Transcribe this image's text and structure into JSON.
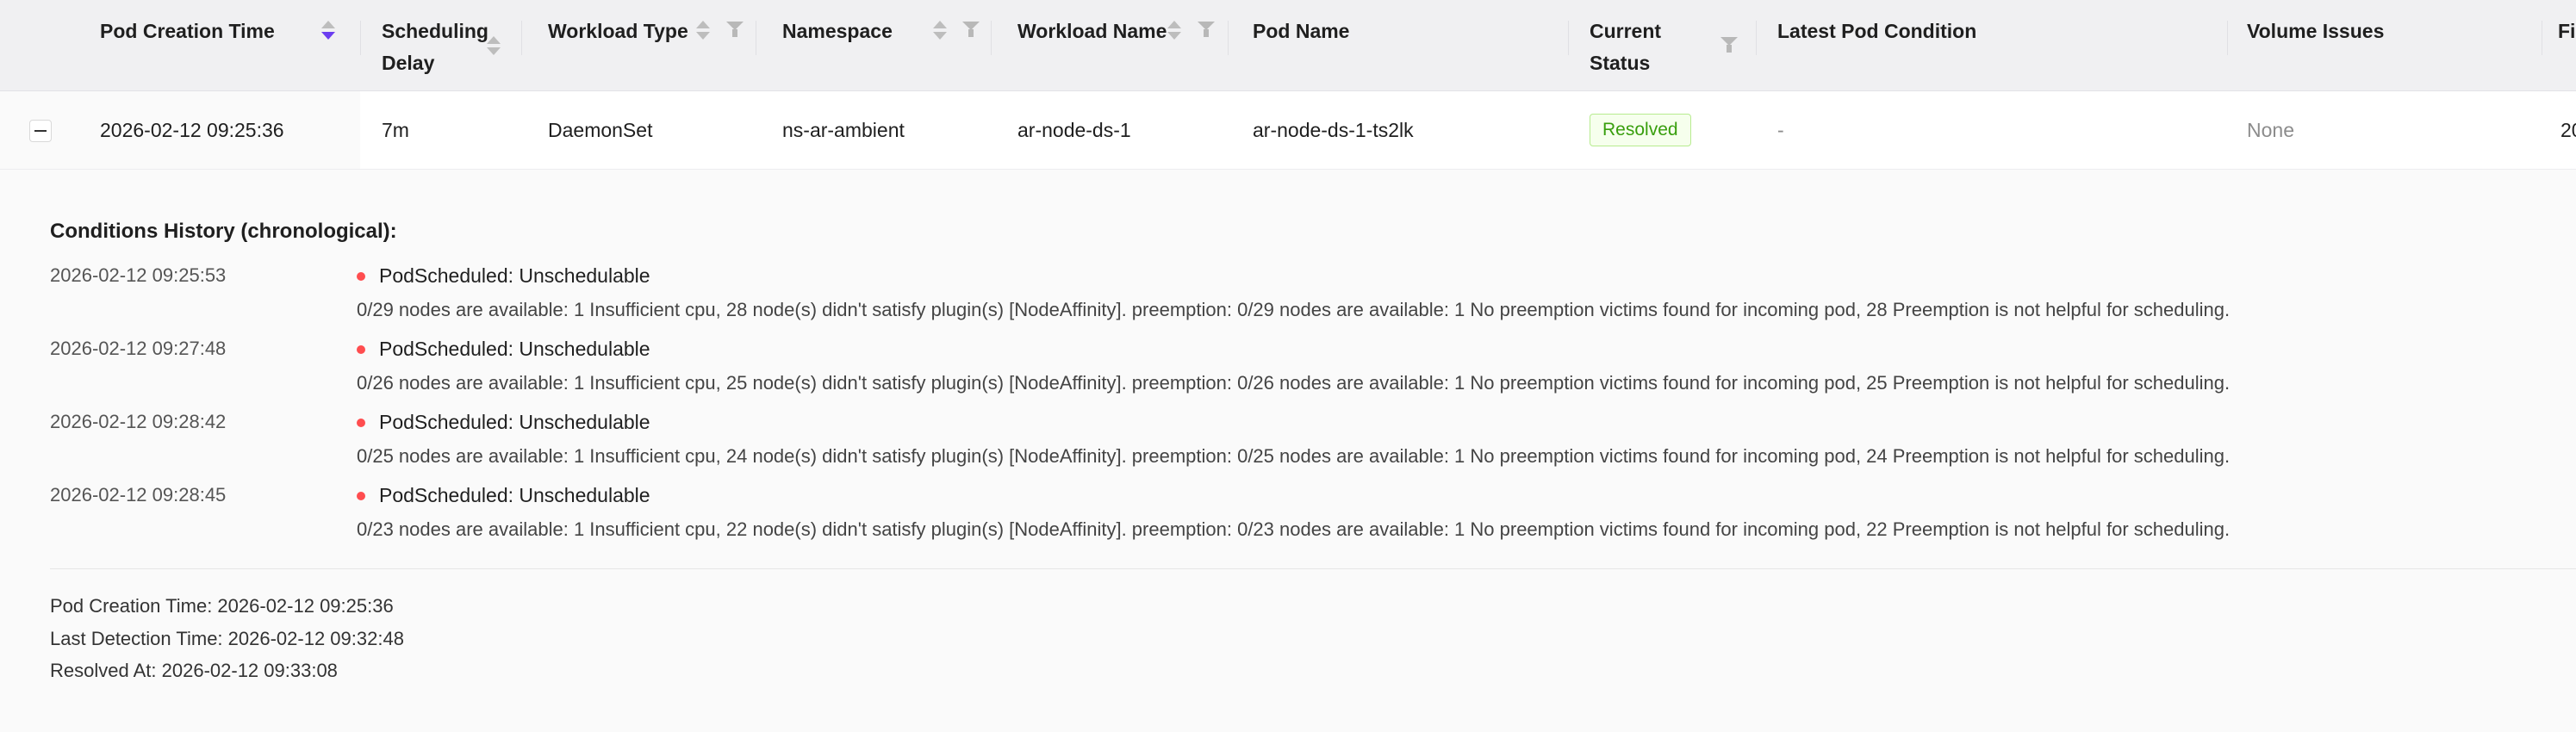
{
  "columns": {
    "pod_creation_time": "Pod Creation Time",
    "scheduling_delay_line1": "Scheduling",
    "scheduling_delay_line2": "Delay",
    "workload_type": "Workload Type",
    "namespace": "Namespace",
    "workload_name": "Workload Name",
    "pod_name": "Pod Name",
    "current_status_line1": "Current",
    "current_status_line2": "Status",
    "latest_pod_condition": "Latest Pod Condition",
    "volume_issues": "Volume Issues",
    "truncated_next": "Fi"
  },
  "row": {
    "pod_creation_time": "2026-02-12 09:25:36",
    "scheduling_delay": "7m",
    "workload_type": "DaemonSet",
    "namespace": "ns-ar-ambient",
    "workload_name": "ar-node-ds-1",
    "pod_name": "ar-node-ds-1-ts2lk",
    "current_status": "Resolved",
    "latest_pod_condition": "-",
    "volume_issues": "None",
    "truncated_next": "20"
  },
  "expanded": {
    "history_title": "Conditions History (chronological):",
    "history": [
      {
        "time": "2026-02-12 09:25:53",
        "reason": "PodScheduled: Unschedulable",
        "message": "0/29 nodes are available: 1 Insufficient cpu, 28 node(s) didn't satisfy plugin(s) [NodeAffinity]. preemption: 0/29 nodes are available: 1 No preemption victims found for incoming pod, 28 Preemption is not helpful for scheduling."
      },
      {
        "time": "2026-02-12 09:27:48",
        "reason": "PodScheduled: Unschedulable",
        "message": "0/26 nodes are available: 1 Insufficient cpu, 25 node(s) didn't satisfy plugin(s) [NodeAffinity]. preemption: 0/26 nodes are available: 1 No preemption victims found for incoming pod, 25 Preemption is not helpful for scheduling."
      },
      {
        "time": "2026-02-12 09:28:42",
        "reason": "PodScheduled: Unschedulable",
        "message": "0/25 nodes are available: 1 Insufficient cpu, 24 node(s) didn't satisfy plugin(s) [NodeAffinity]. preemption: 0/25 nodes are available: 1 No preemption victims found for incoming pod, 24 Preemption is not helpful for scheduling."
      },
      {
        "time": "2026-02-12 09:28:45",
        "reason": "PodScheduled: Unschedulable",
        "message": "0/23 nodes are available: 1 Insufficient cpu, 22 node(s) didn't satisfy plugin(s) [NodeAffinity]. preemption: 0/23 nodes are available: 1 No preemption victims found for incoming pod, 22 Preemption is not helpful for scheduling."
      }
    ],
    "pod_creation_time": "Pod Creation Time: 2026-02-12 09:25:36",
    "last_detection_time": "Last Detection Time: 2026-02-12 09:32:48",
    "resolved_at": "Resolved At: 2026-02-12 09:33:08"
  },
  "colors": {
    "accent_sort": "#6b3df0",
    "status_resolved": "#389e0d",
    "condition_dot": "#ff4d4f"
  }
}
